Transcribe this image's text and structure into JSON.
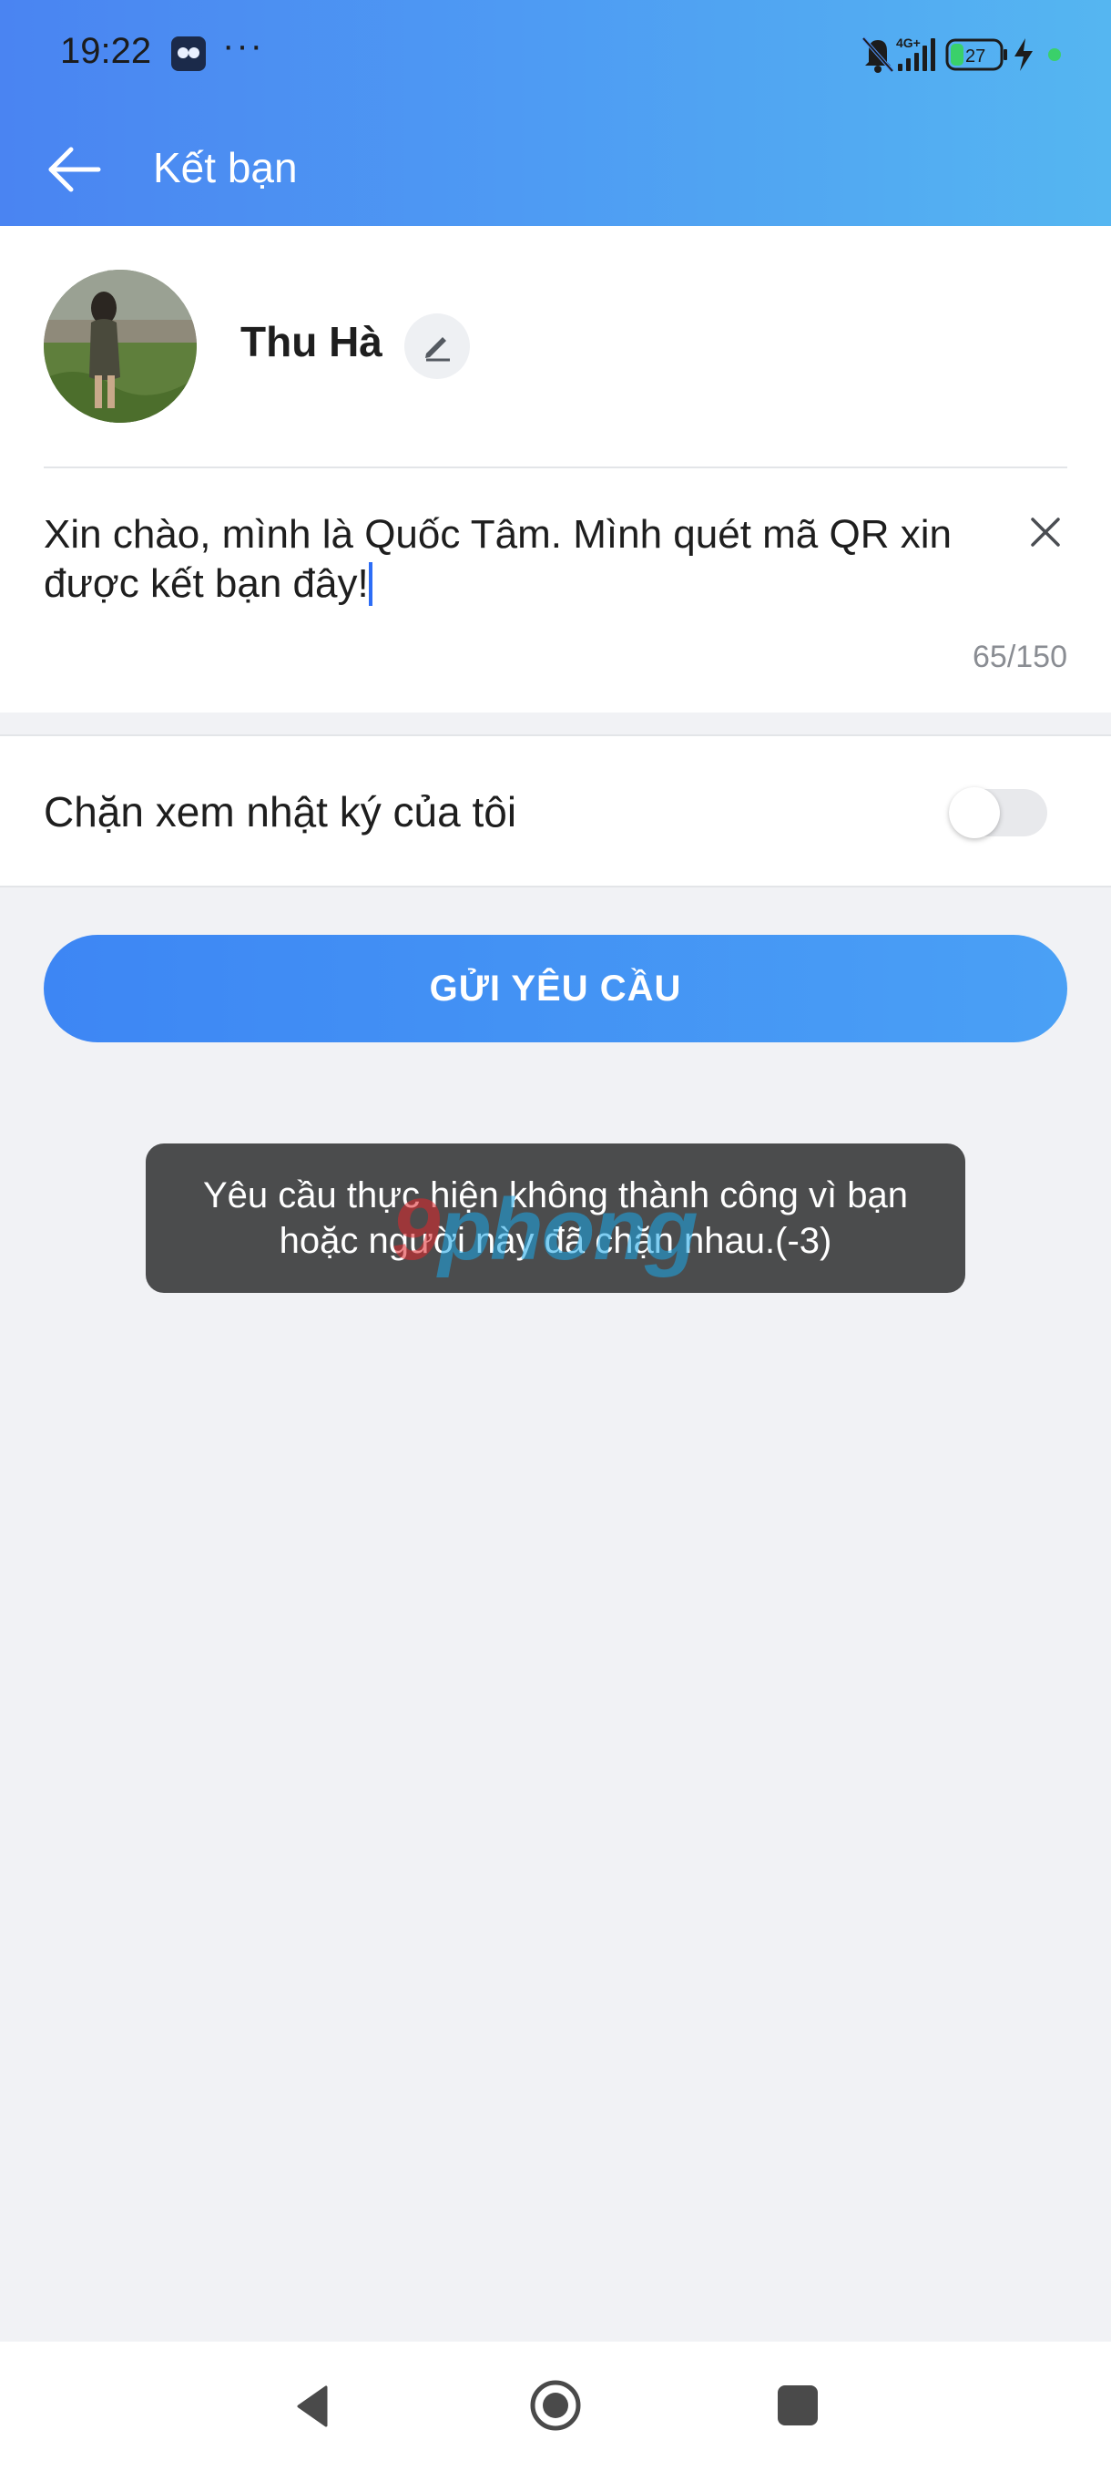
{
  "status_bar": {
    "time": "19:22",
    "more": "···",
    "network": "4G+",
    "battery": "27",
    "icons": [
      "app-notification-icon",
      "mute-bell-icon",
      "signal-icon",
      "battery-icon",
      "charging-icon",
      "dot-indicator-icon"
    ]
  },
  "app_bar": {
    "title": "Kết bạn",
    "back_icon": "arrow-left-icon"
  },
  "profile": {
    "name": "Thu Hà",
    "edit_icon": "pencil-icon"
  },
  "message": {
    "text": "Xin chào, mình là Quốc Tâm. Mình quét mã QR xin được kết bạn đây!",
    "counter": "65/150",
    "clear_icon": "close-icon"
  },
  "settings": {
    "block_diary_label": "Chặn xem nhật ký của tôi",
    "block_diary_enabled": false
  },
  "send_button_label": "GỬI YÊU CẦU",
  "toast": {
    "text": "Yêu cầu thực hiện không thành công vì bạn hoặc người này đã chặn nhau.(-3)"
  },
  "watermark": {
    "part1": "9",
    "part2": "phong"
  },
  "nav": {
    "icons": [
      "nav-back-icon",
      "nav-home-icon",
      "nav-recents-icon"
    ]
  },
  "colors": {
    "header_start": "#4a84f2",
    "header_end": "#55b6f1",
    "button": "#3d86f4",
    "toast_bg": "#4b4c4d"
  }
}
